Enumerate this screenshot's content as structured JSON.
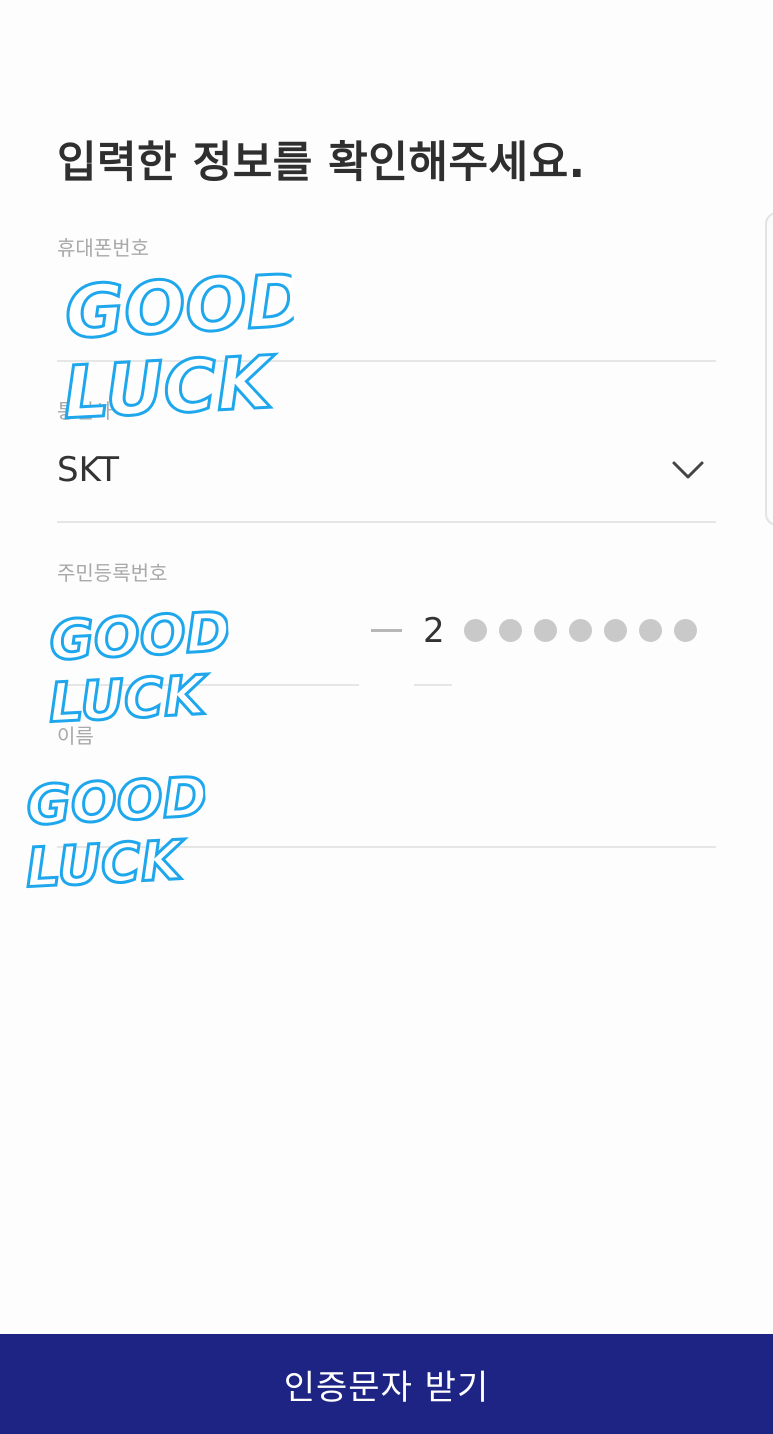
{
  "page": {
    "title": "입력한 정보를 확인해주세요."
  },
  "form": {
    "phone": {
      "label": "휴대폰번호",
      "value": ""
    },
    "carrier": {
      "label": "통신사",
      "value": "SKT",
      "icon": "chevron-down-icon"
    },
    "rrn": {
      "label": "주민등록번호",
      "front_value": "",
      "separator": "—",
      "back_first_digit": "2",
      "masked_dot_count": 7
    },
    "name": {
      "label": "이름",
      "value": ""
    }
  },
  "stickers": {
    "line1": "GOOD",
    "line2": "LUCK",
    "color": "#1ea7ec"
  },
  "footer": {
    "cta_label": "인증문자 받기",
    "cta_color": "#1d2484"
  }
}
